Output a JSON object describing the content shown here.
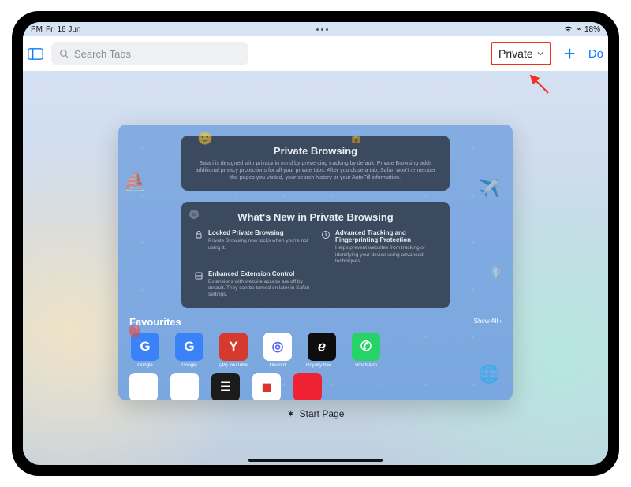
{
  "status": {
    "time_label": "PM",
    "date": "Fri 16 Jun",
    "battery": "18%"
  },
  "toolbar": {
    "search_placeholder": "Search Tabs",
    "group_label": "Private",
    "done": "Do"
  },
  "preview": {
    "hero": {
      "title": "Private Browsing",
      "body": "Safari is designed with privacy in mind by preventing tracking by default. Private Browsing adds additional privacy protections for all your private tabs. After you close a tab, Safari won't remember the pages you visited, your search history or your AutoFill information."
    },
    "whatsnew": {
      "title": "What's New in Private Browsing",
      "items": [
        {
          "title": "Locked Private Browsing",
          "body": "Private Browsing now locks when you're not using it."
        },
        {
          "title": "Advanced Tracking and Fingerprinting Protection",
          "body": "Helps prevent websites from tracking or identifying your device using advanced techniques."
        },
        {
          "title": "Enhanced Extension Control",
          "body": "Extensions with website access are off by default. They can be turned on later in Safari settings."
        }
      ]
    },
    "favourites": {
      "title": "Favourites",
      "show_all": "Show All",
      "items": [
        {
          "label": "Google",
          "glyph": "G",
          "bg": "#3a82f7"
        },
        {
          "label": "Google",
          "glyph": "G",
          "bg": "#3a82f7"
        },
        {
          "label": "(48) YouTube",
          "glyph": "Y",
          "bg": "#d63a2e"
        },
        {
          "label": "Discord",
          "glyph": "◎",
          "bg": "#ffffff",
          "fg": "#5865f2"
        },
        {
          "label": "Royalty free music and s…",
          "glyph": "ℯ",
          "bg": "#0d0d0d"
        },
        {
          "label": "WhatsApp",
          "glyph": "✆",
          "bg": "#25d366"
        }
      ]
    }
  },
  "tab_caption": "Start Page"
}
